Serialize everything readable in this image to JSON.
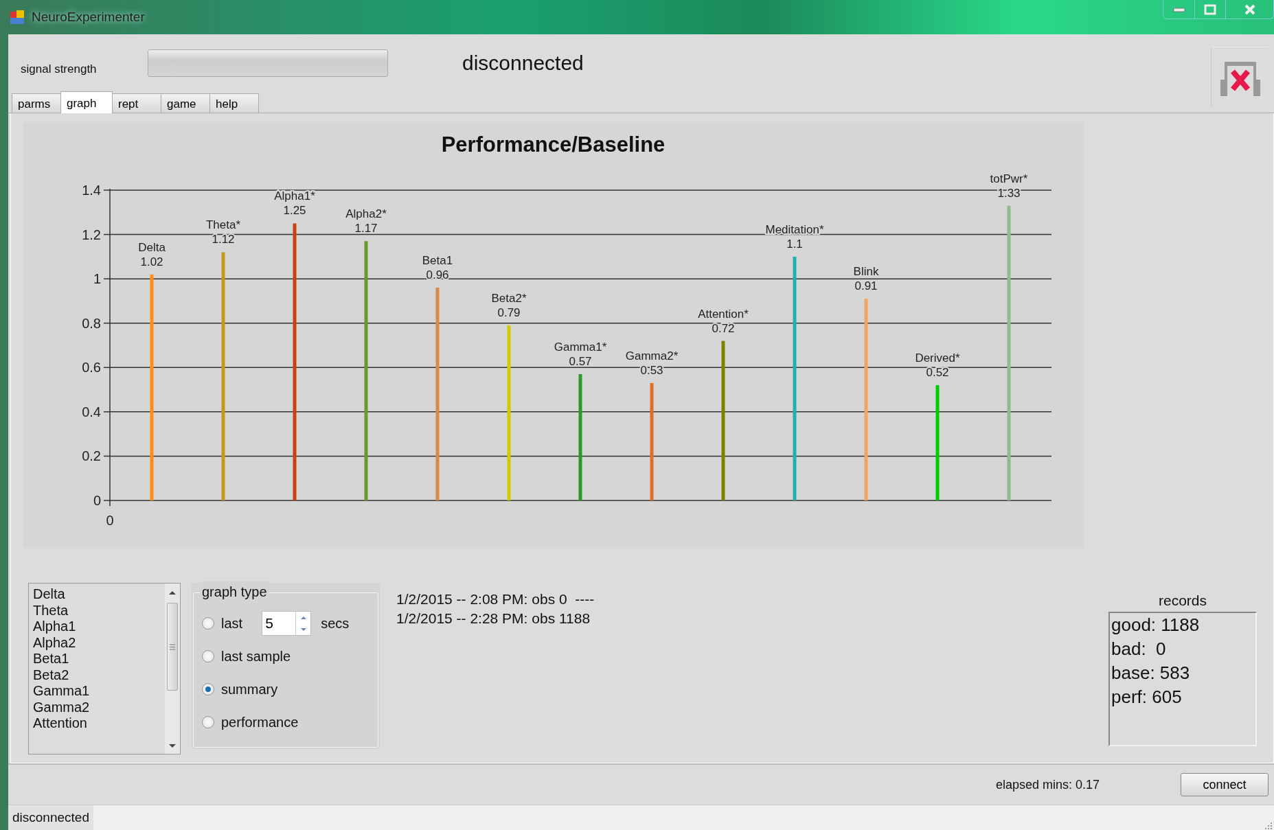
{
  "window": {
    "title": "NeuroExperimenter"
  },
  "header": {
    "signal_label": "signal strength",
    "signal": {
      "level": 0
    },
    "connection_status": "disconnected"
  },
  "tabs": [
    {
      "label": "parms",
      "selected": false
    },
    {
      "label": "graph",
      "selected": true
    },
    {
      "label": "rept",
      "selected": false
    },
    {
      "label": "game",
      "selected": false
    },
    {
      "label": "help",
      "selected": false
    }
  ],
  "chart": {
    "chart_data": {
      "type": "bar",
      "title": "Performance/Baseline",
      "categories": [
        "Delta",
        "Theta*",
        "Alpha1*",
        "Alpha2*",
        "Beta1",
        "Beta2*",
        "Gamma1*",
        "Gamma2*",
        "Attention*",
        "Meditation*",
        "Blink",
        "Derived*",
        "totPwr*"
      ],
      "series": [
        {
          "values": [
            1.02,
            1.12,
            1.25,
            1.17,
            0.96,
            0.79,
            0.57,
            0.53,
            0.72,
            1.1,
            0.91,
            0.52,
            1.33
          ]
        }
      ],
      "colors": [
        "#ff8c1a",
        "#c8961e",
        "#cc4010",
        "#6b9a2a",
        "#d9894a",
        "#cccc00",
        "#2a9a2a",
        "#e07020",
        "#808000",
        "#20b2aa",
        "#f4a460",
        "#00cc00",
        "#8fbc8f"
      ],
      "ylim": [
        0,
        1.4
      ],
      "yticks": [
        0,
        0.2,
        0.4,
        0.6,
        0.8,
        1,
        1.2,
        1.4
      ],
      "grid": true,
      "data_labels": true
    },
    "x_origin_label": "0"
  },
  "band_list": {
    "items": [
      "Delta",
      "Theta",
      "Alpha1",
      "Alpha2",
      "Beta1",
      "Beta2",
      "Gamma1",
      "Gamma2",
      "Attention"
    ]
  },
  "graph_type": {
    "label": "graph type",
    "options": [
      {
        "label": "last",
        "selected": false,
        "spinner": "5",
        "suffix": "secs"
      },
      {
        "label": "last sample",
        "selected": false
      },
      {
        "label": "summary",
        "selected": true
      },
      {
        "label": "performance",
        "selected": false
      }
    ]
  },
  "log": [
    "1/2/2015 -- 2:08 PM: obs 0  ----",
    "1/2/2015 -- 2:28 PM: obs 1188"
  ],
  "records": {
    "title": "records",
    "lines": [
      "good: 1188",
      "bad:  0",
      "base: 583",
      "perf: 605"
    ]
  },
  "footer": {
    "elapsed": "elapsed mins: 0.17",
    "connect_button": "connect"
  },
  "status_bar": {
    "text": "disconnected"
  }
}
